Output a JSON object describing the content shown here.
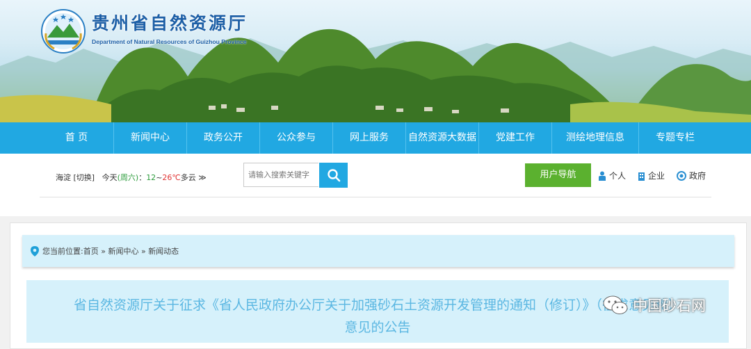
{
  "header": {
    "site_title": "贵州省自然资源厅",
    "site_subtitle": "Department of Natural Resources of Guizhou Province"
  },
  "nav": {
    "items": [
      {
        "label": "首  页"
      },
      {
        "label": "新闻中心"
      },
      {
        "label": "政务公开"
      },
      {
        "label": "公众参与"
      },
      {
        "label": "网上服务"
      },
      {
        "label": "自然资源大数据"
      },
      {
        "label": "党建工作"
      },
      {
        "label": "测绘地理信息"
      },
      {
        "label": "专题专栏"
      }
    ]
  },
  "toolbar": {
    "location": "海淀",
    "switch_label": "[切换]",
    "today_label": "今天",
    "weekday": "(周六)",
    "temp_low": "12",
    "temp_sep": "~",
    "temp_high": "26℃",
    "condition": "多云",
    "more_glyph": "≫",
    "search_placeholder": "请输入搜索关键字",
    "user_nav_label": "用户导航",
    "roles": [
      {
        "label": "个人",
        "icon": "person-icon"
      },
      {
        "label": "企业",
        "icon": "building-icon"
      },
      {
        "label": "政府",
        "icon": "gov-icon"
      }
    ]
  },
  "breadcrumb": {
    "prefix": "您当前位置:",
    "items": [
      "首页",
      "新闻中心",
      "新闻动态"
    ],
    "separator": "»"
  },
  "article": {
    "title_line1": "省自然资源厅关于征求《省人民政府办公厅关于加强砂石土资源开发管理的通知（修订）》（征求意见稿）",
    "title_line2": "意见的公告"
  },
  "watermark": {
    "text": "中国砂石网"
  },
  "colors": {
    "nav_bg": "#21a8e2",
    "user_nav_bg": "#5bb12f",
    "title_blue": "#1d5fa6",
    "article_title": "#5bb7e2",
    "panel_bg": "#d6f1fb"
  }
}
